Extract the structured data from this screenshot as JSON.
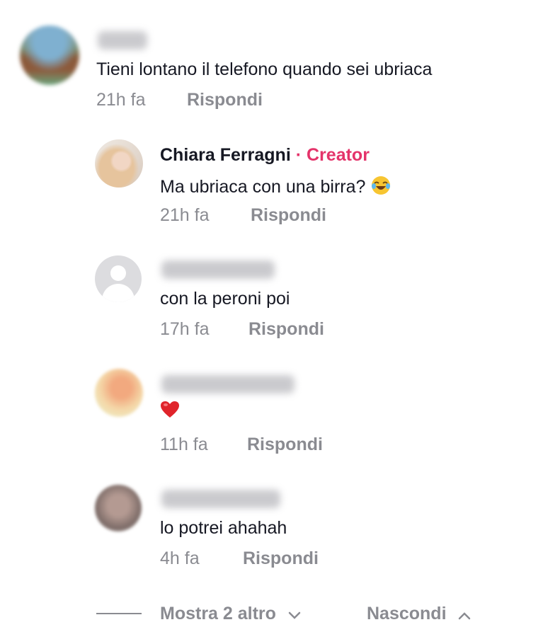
{
  "comments": [
    {
      "username": "",
      "text": "Tieni lontano il telefono quando sei ubriaca",
      "time": "21h fa",
      "reply_label": "Rispondi"
    },
    {
      "username": "Chiara Ferragni",
      "badge": "· Creator",
      "text": "Ma ubriaca con una birra?",
      "emoji": "laughing-tears-emoji",
      "time": "21h fa",
      "reply_label": "Rispondi"
    },
    {
      "username": "",
      "text": "con la peroni poi",
      "time": "17h fa",
      "reply_label": "Rispondi"
    },
    {
      "username": "",
      "text": "",
      "emoji": "red-heart-emoji",
      "time": "11h fa",
      "reply_label": "Rispondi"
    },
    {
      "username": "",
      "text": "lo potrei ahahah",
      "time": "4h fa",
      "reply_label": "Rispondi"
    }
  ],
  "footer": {
    "show_more_label": "Mostra 2 altro",
    "hide_label": "Nascondi"
  },
  "colors": {
    "text": "#161823",
    "muted": "#8a8b91",
    "creator": "#e4336a"
  }
}
